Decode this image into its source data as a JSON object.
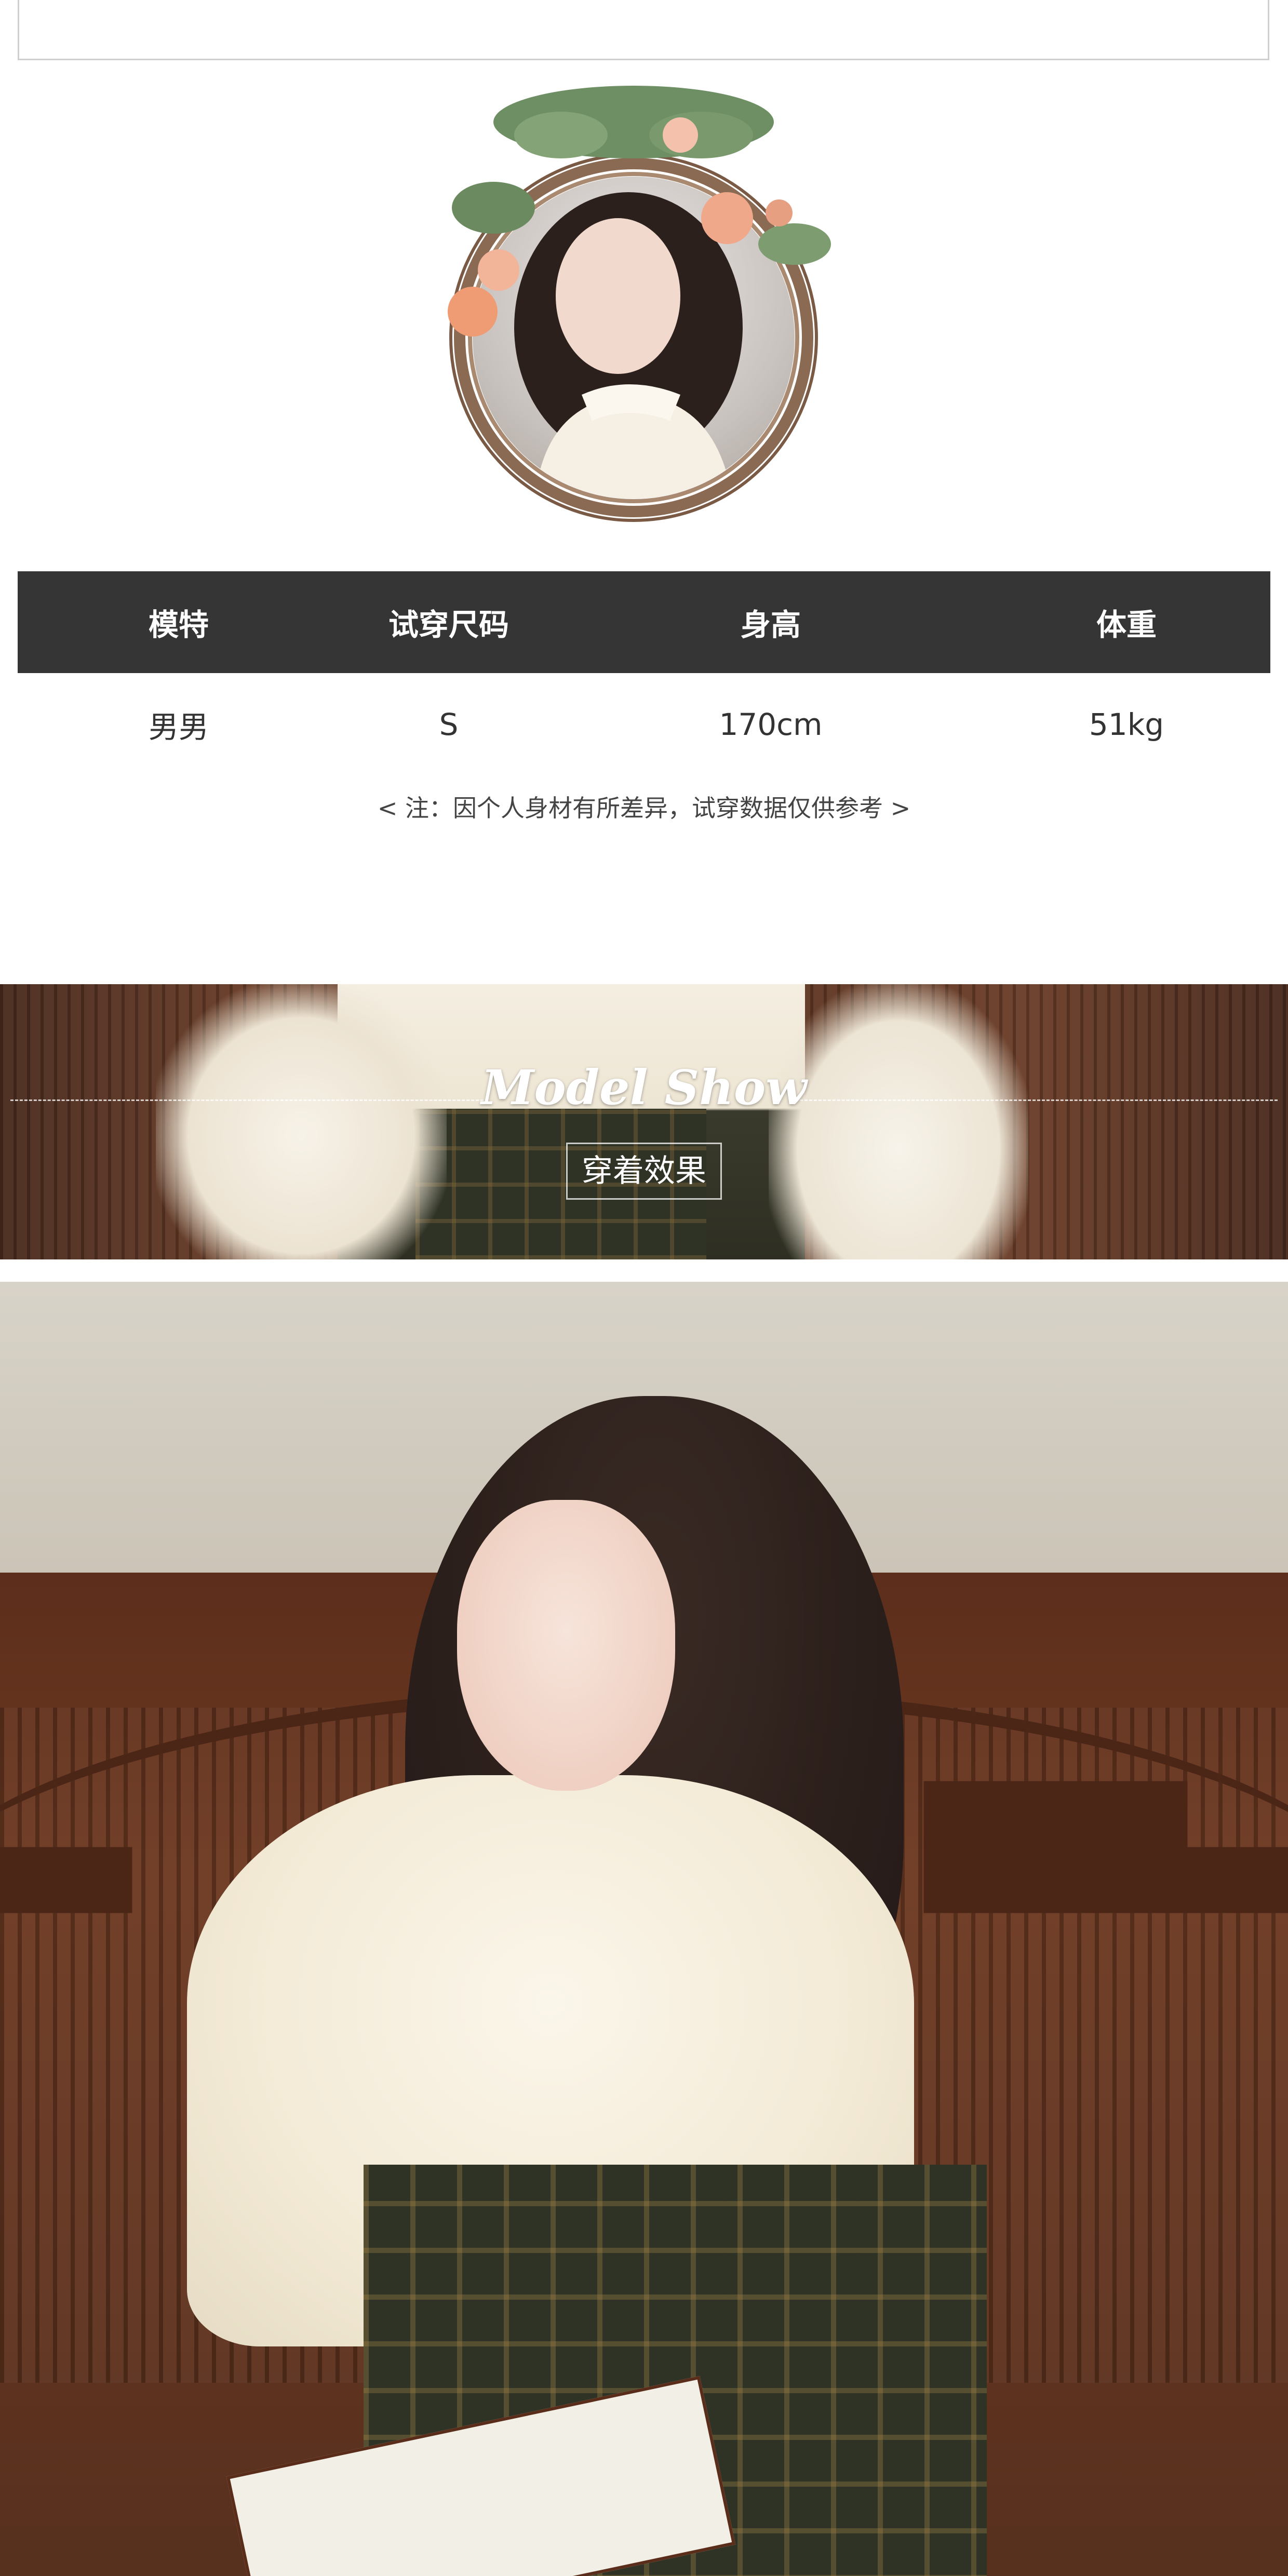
{
  "table": {
    "headers": [
      "模特",
      "试穿尺码",
      "身高",
      "体重"
    ],
    "row": [
      "男男",
      "S",
      "170cm",
      "51kg"
    ]
  },
  "note": "<  注：因个人身材有所差异，试穿数据仅供参考  >",
  "banner": {
    "title": "Model Show",
    "subtitle": "穿着效果"
  },
  "colors": {
    "table_header_bg": "#353535",
    "table_header_text": "#ffffff",
    "body_text": "#333333"
  }
}
